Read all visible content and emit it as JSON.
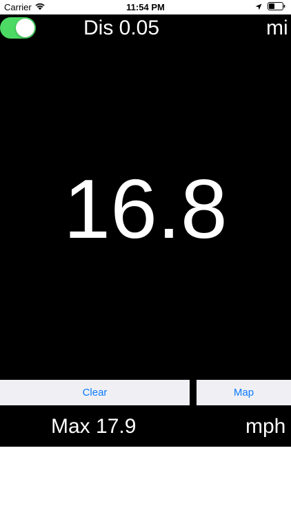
{
  "status_bar": {
    "carrier": "Carrier",
    "time": "11:54 PM",
    "icons": [
      "wifi-icon",
      "location-icon",
      "battery-icon"
    ]
  },
  "toggle": {
    "state": "on",
    "color": "#4cd964"
  },
  "distance": {
    "label": "Dis 0.05",
    "unit": "mi"
  },
  "speed": {
    "value": "16.8",
    "unit": "mph"
  },
  "buttons": {
    "clear_label": "Clear",
    "map_label": "Map",
    "text_color": "#0a7aff"
  },
  "max": {
    "label": "Max 17.9"
  }
}
